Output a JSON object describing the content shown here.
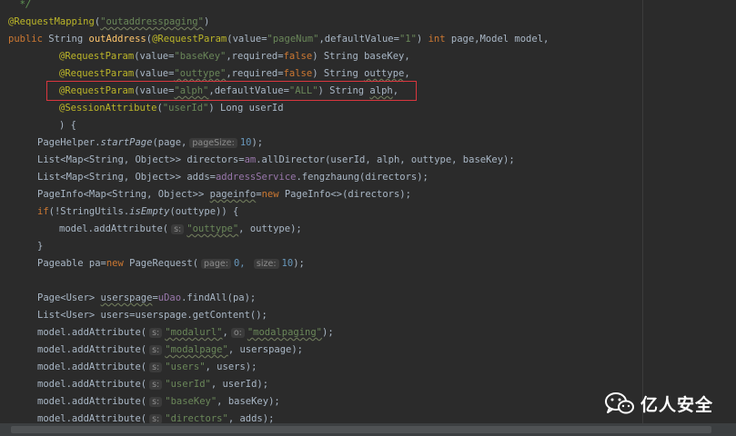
{
  "editor": {
    "lines": [
      {
        "indent": 0,
        "segments": [
          {
            "t": "  */",
            "c": "cmt"
          }
        ]
      },
      {
        "indent": 0,
        "segments": [
          {
            "t": "@RequestMapping",
            "c": "ann"
          },
          {
            "t": "(",
            "c": "plain"
          },
          {
            "t": "\"outaddresspaging\"",
            "c": "str ul"
          },
          {
            "t": ")",
            "c": "plain"
          }
        ]
      },
      {
        "indent": 0,
        "segments": [
          {
            "t": "public ",
            "c": "kw"
          },
          {
            "t": "String ",
            "c": "plain"
          },
          {
            "t": "outAddress",
            "c": "mth"
          },
          {
            "t": "(",
            "c": "plain"
          },
          {
            "t": "@RequestParam",
            "c": "ann"
          },
          {
            "t": "(value=",
            "c": "plain"
          },
          {
            "t": "\"pageNum\"",
            "c": "str"
          },
          {
            "t": ",defaultValue=",
            "c": "plain"
          },
          {
            "t": "\"1\"",
            "c": "str"
          },
          {
            "t": ") ",
            "c": "plain"
          },
          {
            "t": "int ",
            "c": "kw"
          },
          {
            "t": "page,Model model,",
            "c": "plain"
          }
        ]
      },
      {
        "indent": 56,
        "segments": [
          {
            "t": "@RequestParam",
            "c": "ann"
          },
          {
            "t": "(value=",
            "c": "plain"
          },
          {
            "t": "\"baseKey\"",
            "c": "str"
          },
          {
            "t": ",required=",
            "c": "plain"
          },
          {
            "t": "false",
            "c": "kw"
          },
          {
            "t": ") String baseKey,",
            "c": "plain"
          }
        ]
      },
      {
        "indent": 56,
        "segments": [
          {
            "t": "@RequestParam",
            "c": "ann"
          },
          {
            "t": "(value=",
            "c": "plain"
          },
          {
            "t": "\"outtype\"",
            "c": "str ul"
          },
          {
            "t": ",required=",
            "c": "plain"
          },
          {
            "t": "false",
            "c": "kw"
          },
          {
            "t": ") String ",
            "c": "plain"
          },
          {
            "t": "outtype",
            "c": "plain ul"
          },
          {
            "t": ",",
            "c": "plain"
          }
        ]
      },
      {
        "indent": 56,
        "segments": [
          {
            "t": "@RequestParam",
            "c": "ann"
          },
          {
            "t": "(value=",
            "c": "plain"
          },
          {
            "t": "\"alph\"",
            "c": "str ul"
          },
          {
            "t": ",defaultValue=",
            "c": "plain"
          },
          {
            "t": "\"ALL\"",
            "c": "str"
          },
          {
            "t": ") String ",
            "c": "plain"
          },
          {
            "t": "alph",
            "c": "plain ul"
          },
          {
            "t": ",",
            "c": "plain"
          }
        ]
      },
      {
        "indent": 56,
        "segments": [
          {
            "t": "@SessionAttribute",
            "c": "ann"
          },
          {
            "t": "(",
            "c": "plain"
          },
          {
            "t": "\"userId\"",
            "c": "str"
          },
          {
            "t": ") Long userId",
            "c": "plain"
          }
        ]
      },
      {
        "indent": 56,
        "segments": [
          {
            "t": ") {",
            "c": "plain"
          }
        ]
      },
      {
        "indent": 32,
        "segments": [
          {
            "t": "PageHelper.",
            "c": "plain"
          },
          {
            "t": "startPage",
            "c": "plain sta"
          },
          {
            "t": "(page,",
            "c": "plain"
          },
          {
            "t": "pageSize:",
            "c": "hint"
          },
          {
            "t": "10",
            "c": "num"
          },
          {
            "t": ");",
            "c": "plain"
          }
        ]
      },
      {
        "indent": 32,
        "segments": [
          {
            "t": "List<Map<String, Object>> directors=",
            "c": "plain"
          },
          {
            "t": "am",
            "c": "fld"
          },
          {
            "t": ".allDirector(userId, alph, outtype, baseKey);",
            "c": "plain"
          }
        ]
      },
      {
        "indent": 32,
        "segments": [
          {
            "t": "List<Map<String, Object>> adds=",
            "c": "plain"
          },
          {
            "t": "addressService",
            "c": "fld"
          },
          {
            "t": ".fengzhaung(directors);",
            "c": "plain"
          }
        ]
      },
      {
        "indent": 32,
        "segments": [
          {
            "t": "PageInfo<Map<String, Object>> ",
            "c": "plain"
          },
          {
            "t": "pageinfo",
            "c": "plain ul"
          },
          {
            "t": "=",
            "c": "plain"
          },
          {
            "t": "new ",
            "c": "kw"
          },
          {
            "t": "PageInfo<>(directors);",
            "c": "plain"
          }
        ]
      },
      {
        "indent": 32,
        "segments": [
          {
            "t": "if",
            "c": "kw"
          },
          {
            "t": "(!StringUtils.",
            "c": "plain"
          },
          {
            "t": "isEmpty",
            "c": "plain sta"
          },
          {
            "t": "(outtype)) {",
            "c": "plain"
          }
        ]
      },
      {
        "indent": 56,
        "segments": [
          {
            "t": "model.addAttribute(",
            "c": "plain"
          },
          {
            "t": "s:",
            "c": "hint"
          },
          {
            "t": "\"outtype\"",
            "c": "str ul"
          },
          {
            "t": ", outtype);",
            "c": "plain"
          }
        ]
      },
      {
        "indent": 32,
        "segments": [
          {
            "t": "}",
            "c": "plain"
          }
        ]
      },
      {
        "indent": 32,
        "segments": [
          {
            "t": "Pageable pa=",
            "c": "plain"
          },
          {
            "t": "new ",
            "c": "kw"
          },
          {
            "t": "PageRequest(",
            "c": "plain"
          },
          {
            "t": "page:",
            "c": "hint"
          },
          {
            "t": "0, ",
            "c": "num"
          },
          {
            "t": "size:",
            "c": "hint"
          },
          {
            "t": "10",
            "c": "num"
          },
          {
            "t": ");",
            "c": "plain"
          }
        ]
      },
      {
        "indent": 0,
        "segments": []
      },
      {
        "indent": 32,
        "segments": [
          {
            "t": "Page<User> ",
            "c": "plain"
          },
          {
            "t": "userspage",
            "c": "plain ul"
          },
          {
            "t": "=",
            "c": "plain"
          },
          {
            "t": "uDao",
            "c": "fld"
          },
          {
            "t": ".findAll(pa);",
            "c": "plain"
          }
        ]
      },
      {
        "indent": 32,
        "segments": [
          {
            "t": "List<User> users=userspage.getContent();",
            "c": "plain"
          }
        ]
      },
      {
        "indent": 32,
        "segments": [
          {
            "t": "model.addAttribute(",
            "c": "plain"
          },
          {
            "t": "s:",
            "c": "hint"
          },
          {
            "t": "\"modalurl\"",
            "c": "str ul"
          },
          {
            "t": ",",
            "c": "plain"
          },
          {
            "t": "o:",
            "c": "hint"
          },
          {
            "t": "\"modalpaging\"",
            "c": "str ul"
          },
          {
            "t": ");",
            "c": "plain"
          }
        ]
      },
      {
        "indent": 32,
        "segments": [
          {
            "t": "model.addAttribute(",
            "c": "plain"
          },
          {
            "t": "s:",
            "c": "hint"
          },
          {
            "t": "\"modalpage\"",
            "c": "str ul"
          },
          {
            "t": ", userspage);",
            "c": "plain"
          }
        ]
      },
      {
        "indent": 32,
        "segments": [
          {
            "t": "model.addAttribute(",
            "c": "plain"
          },
          {
            "t": "s:",
            "c": "hint"
          },
          {
            "t": "\"users\"",
            "c": "str"
          },
          {
            "t": ", users);",
            "c": "plain"
          }
        ]
      },
      {
        "indent": 32,
        "segments": [
          {
            "t": "model.addAttribute(",
            "c": "plain"
          },
          {
            "t": "s:",
            "c": "hint"
          },
          {
            "t": "\"userId\"",
            "c": "str"
          },
          {
            "t": ", userId);",
            "c": "plain"
          }
        ]
      },
      {
        "indent": 32,
        "segments": [
          {
            "t": "model.addAttribute(",
            "c": "plain"
          },
          {
            "t": "s:",
            "c": "hint"
          },
          {
            "t": "\"baseKey\"",
            "c": "str"
          },
          {
            "t": ", baseKey);",
            "c": "plain"
          }
        ]
      },
      {
        "indent": 32,
        "segments": [
          {
            "t": "model.addAttribute(",
            "c": "plain"
          },
          {
            "t": "s:",
            "c": "hint"
          },
          {
            "t": "\"directors\"",
            "c": "str"
          },
          {
            "t": ", adds);",
            "c": "plain"
          }
        ]
      }
    ]
  },
  "watermark": {
    "text": "亿人安全",
    "icon": "wechat-icon"
  },
  "colors": {
    "background": "#2b2b2b",
    "highlight_border": "#d9363e"
  }
}
